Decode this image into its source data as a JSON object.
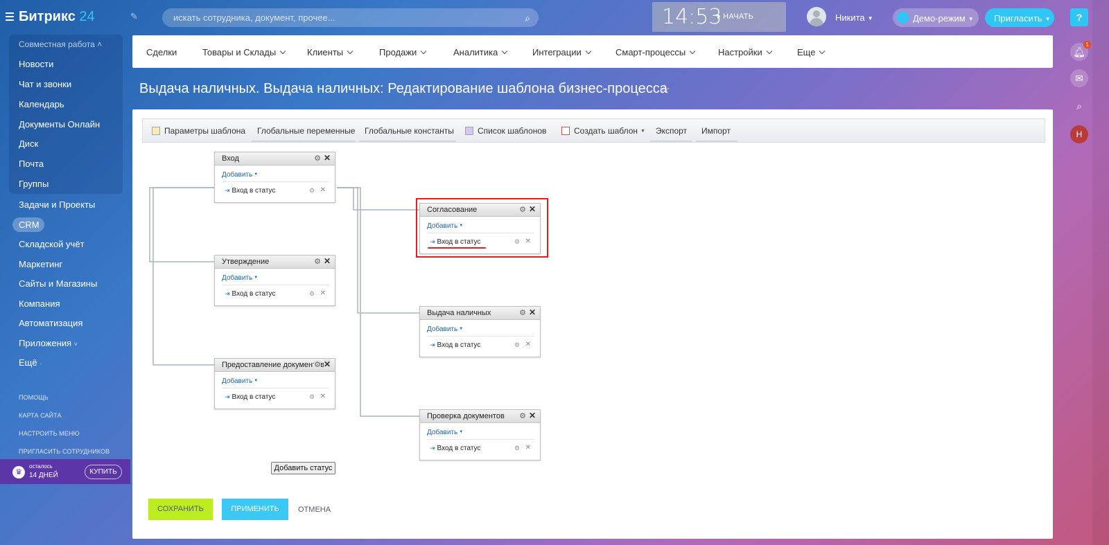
{
  "header": {
    "logo_text": "Битрикс",
    "logo_num": "24",
    "search_placeholder": "искать сотрудника, документ, прочее...",
    "time": "14:53",
    "start_label": "НАЧАТЬ",
    "user_name": "Никита",
    "demo_label": "Демо-режим",
    "invite_label": "Пригласить",
    "help_label": "?",
    "notif_count": "1",
    "user_initial": "Н"
  },
  "sidebar": {
    "group_title": "Совместная работа",
    "group_items": [
      "Новости",
      "Чат и звонки",
      "Календарь",
      "Документы Онлайн",
      "Диск",
      "Почта",
      "Группы"
    ],
    "items": [
      "Задачи и Проекты",
      "CRM",
      "Складской учёт",
      "Маркетинг",
      "Сайты и Магазины",
      "Компания",
      "Автоматизация",
      "Приложения",
      "Ещё"
    ],
    "links": [
      "ПОМОЩЬ",
      "КАРТА САЙТА",
      "НАСТРОИТЬ МЕНЮ",
      "ПРИГЛАСИТЬ СОТРУДНИКОВ"
    ],
    "trial_line1": "осталось",
    "trial_line2": "14 ДНЕЙ",
    "buy_label": "КУПИТЬ"
  },
  "nav": [
    "Сделки",
    "Товары и Склады",
    "Клиенты",
    "Продажи",
    "Аналитика",
    "Интеграции",
    "Смарт-процессы",
    "Настройки",
    "Еще"
  ],
  "page_title": "Выдача наличных. Выдача наличных: Редактирование шаблона бизнес-процесса",
  "toolbar": [
    "Параметры шаблона",
    "Глобальные переменные",
    "Глобальные константы",
    "Список шаблонов",
    "Создать шаблон",
    "Экспорт",
    "Импорт"
  ],
  "diagram": {
    "add_label": "Добавить",
    "action_label": "Вход в статус",
    "statuses": [
      "Вход",
      "Утверждение",
      "Предоставление документов",
      "Согласование",
      "Выдача наличных",
      "Проверка документов"
    ],
    "add_status_label": "Добавить статус"
  },
  "footer": {
    "save": "СОХРАНИТЬ",
    "apply": "ПРИМЕНИТЬ",
    "cancel": "ОТМЕНА"
  }
}
